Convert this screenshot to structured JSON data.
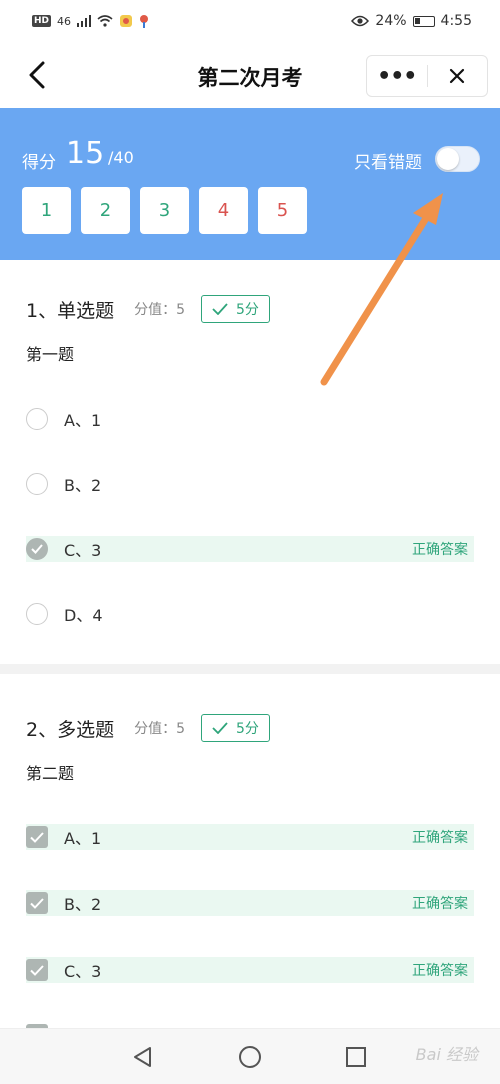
{
  "status_bar": {
    "left": {
      "hd": "HD",
      "network": "46"
    },
    "battery": "24%",
    "time": "4:55"
  },
  "header": {
    "title": "第二次月考",
    "more_label": "•••"
  },
  "score_panel": {
    "score_label": "得分",
    "score": "15",
    "total": "/40",
    "wrong_only_label": "只看错题",
    "wrong_only_enabled": false,
    "question_numbers": [
      {
        "label": "1",
        "state": "correct"
      },
      {
        "label": "2",
        "state": "correct"
      },
      {
        "label": "3",
        "state": "correct"
      },
      {
        "label": "4",
        "state": "wrong"
      },
      {
        "label": "5",
        "state": "wrong"
      }
    ]
  },
  "colors": {
    "panel": "#6aa7f2",
    "correct": "#2fa57b",
    "wrong": "#d9534f",
    "annotation_arrow": "#f0924a"
  },
  "questions": [
    {
      "title": "1、单选题",
      "score_text": "分值：5",
      "badge": "5分",
      "text": "第一题",
      "type": "single",
      "options": [
        {
          "label": "A、1",
          "checked": false,
          "correct": false
        },
        {
          "label": "B、2",
          "checked": false,
          "correct": false
        },
        {
          "label": "C、3",
          "checked": true,
          "correct": true,
          "tag": "正确答案"
        },
        {
          "label": "D、4",
          "checked": false,
          "correct": false
        }
      ]
    },
    {
      "title": "2、多选题",
      "score_text": "分值：5",
      "badge": "5分",
      "text": "第二题",
      "type": "multiple",
      "options": [
        {
          "label": "A、1",
          "checked": true,
          "correct": true,
          "tag": "正确答案"
        },
        {
          "label": "B、2",
          "checked": true,
          "correct": true,
          "tag": "正确答案"
        },
        {
          "label": "C、3",
          "checked": true,
          "correct": true,
          "tag": "正确答案"
        }
      ]
    }
  ],
  "watermark": "Bai 经验"
}
